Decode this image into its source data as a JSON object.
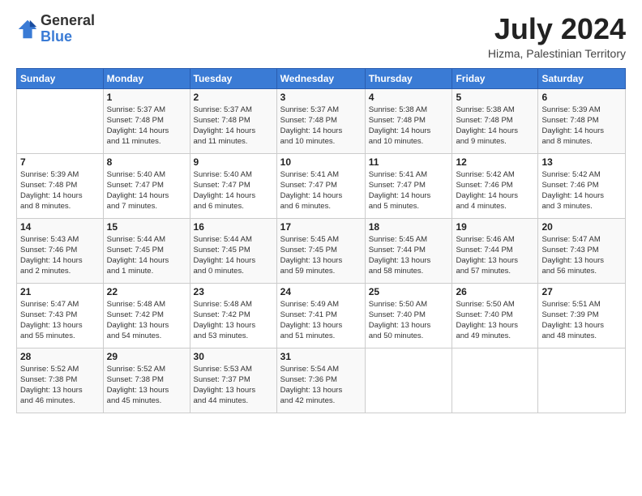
{
  "logo": {
    "general": "General",
    "blue": "Blue"
  },
  "header": {
    "month": "July 2024",
    "location": "Hizma, Palestinian Territory"
  },
  "weekdays": [
    "Sunday",
    "Monday",
    "Tuesday",
    "Wednesday",
    "Thursday",
    "Friday",
    "Saturday"
  ],
  "weeks": [
    [
      {
        "day": "",
        "info": ""
      },
      {
        "day": "1",
        "info": "Sunrise: 5:37 AM\nSunset: 7:48 PM\nDaylight: 14 hours\nand 11 minutes."
      },
      {
        "day": "2",
        "info": "Sunrise: 5:37 AM\nSunset: 7:48 PM\nDaylight: 14 hours\nand 11 minutes."
      },
      {
        "day": "3",
        "info": "Sunrise: 5:37 AM\nSunset: 7:48 PM\nDaylight: 14 hours\nand 10 minutes."
      },
      {
        "day": "4",
        "info": "Sunrise: 5:38 AM\nSunset: 7:48 PM\nDaylight: 14 hours\nand 10 minutes."
      },
      {
        "day": "5",
        "info": "Sunrise: 5:38 AM\nSunset: 7:48 PM\nDaylight: 14 hours\nand 9 minutes."
      },
      {
        "day": "6",
        "info": "Sunrise: 5:39 AM\nSunset: 7:48 PM\nDaylight: 14 hours\nand 8 minutes."
      }
    ],
    [
      {
        "day": "7",
        "info": "Sunrise: 5:39 AM\nSunset: 7:48 PM\nDaylight: 14 hours\nand 8 minutes."
      },
      {
        "day": "8",
        "info": "Sunrise: 5:40 AM\nSunset: 7:47 PM\nDaylight: 14 hours\nand 7 minutes."
      },
      {
        "day": "9",
        "info": "Sunrise: 5:40 AM\nSunset: 7:47 PM\nDaylight: 14 hours\nand 6 minutes."
      },
      {
        "day": "10",
        "info": "Sunrise: 5:41 AM\nSunset: 7:47 PM\nDaylight: 14 hours\nand 6 minutes."
      },
      {
        "day": "11",
        "info": "Sunrise: 5:41 AM\nSunset: 7:47 PM\nDaylight: 14 hours\nand 5 minutes."
      },
      {
        "day": "12",
        "info": "Sunrise: 5:42 AM\nSunset: 7:46 PM\nDaylight: 14 hours\nand 4 minutes."
      },
      {
        "day": "13",
        "info": "Sunrise: 5:42 AM\nSunset: 7:46 PM\nDaylight: 14 hours\nand 3 minutes."
      }
    ],
    [
      {
        "day": "14",
        "info": "Sunrise: 5:43 AM\nSunset: 7:46 PM\nDaylight: 14 hours\nand 2 minutes."
      },
      {
        "day": "15",
        "info": "Sunrise: 5:44 AM\nSunset: 7:45 PM\nDaylight: 14 hours\nand 1 minute."
      },
      {
        "day": "16",
        "info": "Sunrise: 5:44 AM\nSunset: 7:45 PM\nDaylight: 14 hours\nand 0 minutes."
      },
      {
        "day": "17",
        "info": "Sunrise: 5:45 AM\nSunset: 7:45 PM\nDaylight: 13 hours\nand 59 minutes."
      },
      {
        "day": "18",
        "info": "Sunrise: 5:45 AM\nSunset: 7:44 PM\nDaylight: 13 hours\nand 58 minutes."
      },
      {
        "day": "19",
        "info": "Sunrise: 5:46 AM\nSunset: 7:44 PM\nDaylight: 13 hours\nand 57 minutes."
      },
      {
        "day": "20",
        "info": "Sunrise: 5:47 AM\nSunset: 7:43 PM\nDaylight: 13 hours\nand 56 minutes."
      }
    ],
    [
      {
        "day": "21",
        "info": "Sunrise: 5:47 AM\nSunset: 7:43 PM\nDaylight: 13 hours\nand 55 minutes."
      },
      {
        "day": "22",
        "info": "Sunrise: 5:48 AM\nSunset: 7:42 PM\nDaylight: 13 hours\nand 54 minutes."
      },
      {
        "day": "23",
        "info": "Sunrise: 5:48 AM\nSunset: 7:42 PM\nDaylight: 13 hours\nand 53 minutes."
      },
      {
        "day": "24",
        "info": "Sunrise: 5:49 AM\nSunset: 7:41 PM\nDaylight: 13 hours\nand 51 minutes."
      },
      {
        "day": "25",
        "info": "Sunrise: 5:50 AM\nSunset: 7:40 PM\nDaylight: 13 hours\nand 50 minutes."
      },
      {
        "day": "26",
        "info": "Sunrise: 5:50 AM\nSunset: 7:40 PM\nDaylight: 13 hours\nand 49 minutes."
      },
      {
        "day": "27",
        "info": "Sunrise: 5:51 AM\nSunset: 7:39 PM\nDaylight: 13 hours\nand 48 minutes."
      }
    ],
    [
      {
        "day": "28",
        "info": "Sunrise: 5:52 AM\nSunset: 7:38 PM\nDaylight: 13 hours\nand 46 minutes."
      },
      {
        "day": "29",
        "info": "Sunrise: 5:52 AM\nSunset: 7:38 PM\nDaylight: 13 hours\nand 45 minutes."
      },
      {
        "day": "30",
        "info": "Sunrise: 5:53 AM\nSunset: 7:37 PM\nDaylight: 13 hours\nand 44 minutes."
      },
      {
        "day": "31",
        "info": "Sunrise: 5:54 AM\nSunset: 7:36 PM\nDaylight: 13 hours\nand 42 minutes."
      },
      {
        "day": "",
        "info": ""
      },
      {
        "day": "",
        "info": ""
      },
      {
        "day": "",
        "info": ""
      }
    ]
  ]
}
